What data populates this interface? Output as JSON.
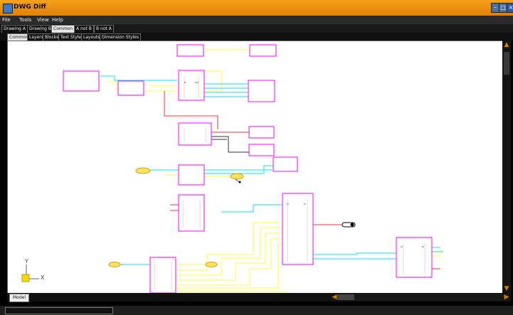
{
  "window": {
    "title": "DWG Diff"
  },
  "menu": [
    "File",
    "Tools",
    "View",
    "Help"
  ],
  "main_tabs": [
    "Drawing A",
    "Drawing B",
    "Common",
    "A not B",
    "B not A"
  ],
  "sub_tabs": [
    "Common",
    "Layers",
    "Blocks",
    "Text Styles",
    "Layouts",
    "Dimension Styles"
  ],
  "canvas": {
    "model_tab": "Model",
    "ucs_labels": {
      "x": "X",
      "y": "Y"
    }
  },
  "colors": {
    "title_bar": "#e58b0f",
    "canvas_bg": "#ffffff",
    "block_border": "#ff00ff",
    "wire_cyan": "#00e5ff",
    "wire_yellow": "#ffff33",
    "wire_red": "#ff3030"
  }
}
